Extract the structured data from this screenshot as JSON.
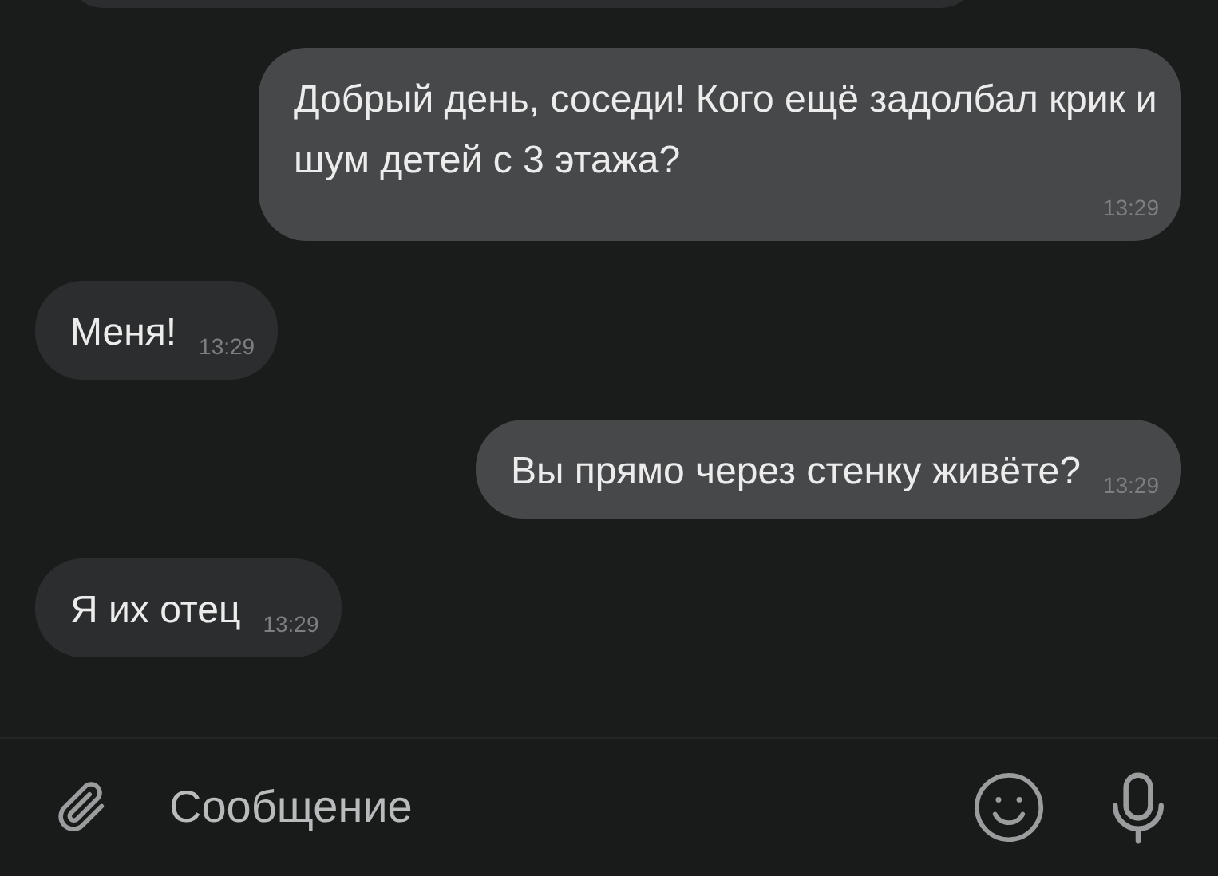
{
  "messages": [
    {
      "kind": "out",
      "text": "Добрый день, соседи! Кого ещё задолбал крик и шум детей с 3 этажа?",
      "time": "13:29"
    },
    {
      "kind": "in",
      "text": "Меня!",
      "time": "13:29"
    },
    {
      "kind": "out",
      "text": "Вы прямо через стенку живёте?",
      "time": "13:29"
    },
    {
      "kind": "in",
      "text": "Я их отец",
      "time": "13:29"
    }
  ],
  "composer": {
    "placeholder": "Сообщение"
  }
}
